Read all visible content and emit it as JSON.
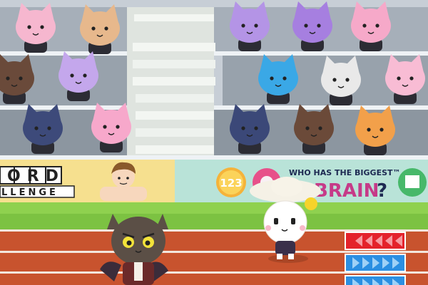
{
  "scene": {
    "title": "stadium-race-scene",
    "colors": {
      "stands_bg": "#c7ced6",
      "bleacher": "#9aa4ae",
      "bleacher_edge": "#eef2f5",
      "stairs": "#e8ece8",
      "grass": "#8fd14f",
      "track": "#c8532e",
      "track_line": "#f3e6dd",
      "red_lane": "#e4222b",
      "blue_lane": "#2b8fe2"
    }
  },
  "banners": {
    "word_challenge": {
      "line1": "ORD",
      "line2": "LLENGE",
      "prefix_cut": "W"
    },
    "brain": {
      "headline": "WHO HAS THE BIGGEST™",
      "word": "BRAIN",
      "question": "?"
    },
    "coin_number": "123"
  },
  "crowd": {
    "spectators": [
      {
        "name": "pink-cat-red-flower",
        "color": "#f6b7cf"
      },
      {
        "name": "tan-dog-sunglasses",
        "color": "#e7b88c"
      },
      {
        "name": "purple-cat-hat",
        "color": "#b494e6"
      },
      {
        "name": "purple-cat-green-bow",
        "color": "#a67fe0"
      },
      {
        "name": "pink-cat-tophat",
        "color": "#f6a9c9"
      },
      {
        "name": "brown-cat",
        "color": "#6a4a3a"
      },
      {
        "name": "lavender-cat-bandaid",
        "color": "#c4a7ec"
      },
      {
        "name": "blue-bird",
        "color": "#3aa8e6"
      },
      {
        "name": "white-haired-cat",
        "color": "#e9e9e9"
      },
      {
        "name": "pink-cat-flower",
        "color": "#f8bcd4"
      },
      {
        "name": "navy-cat-pink-bow",
        "color": "#3d4a7a"
      },
      {
        "name": "pink-cat-tophat-front",
        "color": "#f7a8cb"
      },
      {
        "name": "navy-cat-pink-bow-2",
        "color": "#3b4878"
      },
      {
        "name": "brown-cat-2",
        "color": "#6b4a39"
      },
      {
        "name": "orange-pig-funnel",
        "color": "#f2a04a"
      }
    ]
  },
  "runners": {
    "bat_cat": {
      "color": "#5b4f46",
      "eye": "#f3e33a"
    },
    "white_bunny": {
      "color": "#ffffff",
      "hat": "#f5f1e6"
    }
  },
  "lanes": {
    "red": {
      "direction": "left"
    },
    "blue_1": {
      "direction": "right"
    },
    "blue_2": {
      "direction": "right"
    }
  }
}
